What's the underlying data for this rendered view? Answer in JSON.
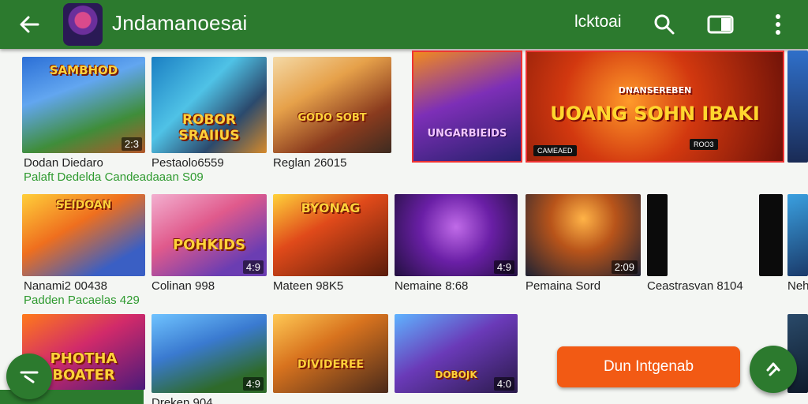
{
  "header": {
    "title": "Jndamanoesai",
    "action_text": "lcktoai",
    "icons": [
      "back-arrow-icon",
      "search-icon",
      "tablet-icon",
      "more-vert-icon"
    ],
    "bar_color": "#2c7a2e"
  },
  "rows": [
    {
      "items": [
        {
          "caption": "Dodan Diedaro",
          "badge": "2:3",
          "art_text": "SAMBHOD"
        },
        {
          "caption": "Pestaolo6559",
          "badge": "",
          "art_text": "ROBOR SRAIIUS"
        },
        {
          "caption": "Reglan 26015",
          "badge": "",
          "art_text": "GODO SOBT"
        }
      ],
      "sub": "Palaft Dedelda Candeadaaan S09"
    },
    {
      "items": [
        {
          "caption": "Nanami2 00438",
          "badge": "",
          "art_text": "SEIDOAN"
        },
        {
          "caption": "Colinan 998",
          "badge": "4:9",
          "art_text": "POHKIDS"
        },
        {
          "caption": "Mateen 98K5",
          "badge": "",
          "art_text": "BYONAG"
        },
        {
          "caption": "Nemaine 8:68",
          "badge": "4:9",
          "art_text": ""
        },
        {
          "caption": "Pemaina Sord",
          "badge": "2:09",
          "art_text": ""
        },
        {
          "caption": "Ceastrasvan 8104",
          "badge": "",
          "art_text": ""
        },
        {
          "caption": "Neh",
          "badge": "",
          "art_text": ""
        }
      ],
      "sub": "Padden Pacaelas 429"
    },
    {
      "items": [
        {
          "caption": "",
          "badge": "",
          "art_text": "PHOTHA BOATER"
        },
        {
          "caption": "Dreken 904",
          "badge": "4:9",
          "art_text": ""
        },
        {
          "caption": "",
          "badge": "",
          "art_text": "DIVIDEREE"
        },
        {
          "caption": "",
          "badge": "4:0",
          "art_text": "DOBOJK"
        }
      ]
    }
  ],
  "banners": [
    {
      "headline": "UNGARBIEIDS"
    },
    {
      "headline": "UOANG SOHN IBAKI",
      "kicker": "DNANSEREBEN",
      "tags": [
        "CAMEAED",
        "ROO3"
      ]
    }
  ],
  "cta": {
    "label": "Dun Intgenab"
  },
  "fabs": {
    "left": "collapse-icon",
    "right": "navigate-icon"
  }
}
